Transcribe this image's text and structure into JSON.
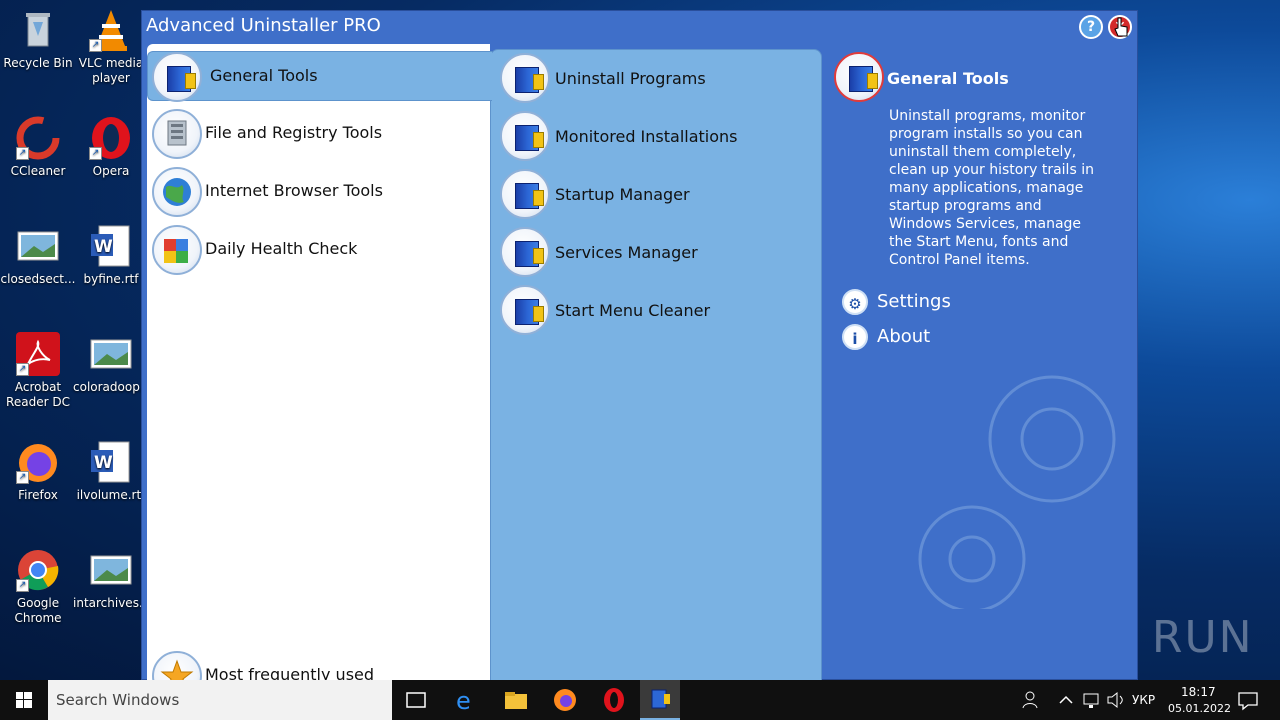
{
  "desktop": {
    "icons": [
      {
        "label": "Recycle Bin"
      },
      {
        "label": "VLC media player"
      },
      {
        "label": "CCleaner"
      },
      {
        "label": "Opera"
      },
      {
        "label": "closedsect..."
      },
      {
        "label": "byfine.rtf"
      },
      {
        "label": "Acrobat Reader DC"
      },
      {
        "label": "coloradoop..."
      },
      {
        "label": "Firefox"
      },
      {
        "label": "ilvolume.rtf"
      },
      {
        "label": "Google Chrome"
      },
      {
        "label": "intarchives..."
      }
    ],
    "watermark": "ANY RUN"
  },
  "window": {
    "title": "Advanced Uninstaller PRO",
    "help_glyph": "?",
    "close_glyph": "✕"
  },
  "categories": [
    {
      "label": "General Tools",
      "selected": true
    },
    {
      "label": "File and Registry Tools"
    },
    {
      "label": "Internet Browser Tools"
    },
    {
      "label": "Daily Health Check"
    },
    {
      "label": "Most frequently used"
    }
  ],
  "tools": [
    {
      "label": "Uninstall Programs"
    },
    {
      "label": "Monitored Installations"
    },
    {
      "label": "Startup Manager"
    },
    {
      "label": "Services Manager"
    },
    {
      "label": "Start Menu Cleaner"
    }
  ],
  "info": {
    "title": "General Tools",
    "description": "Uninstall programs, monitor program installs so you can uninstall them completely, clean up your history trails in many applications, manage startup programs and Windows Services, manage the Start Menu, fonts and Control Panel items.",
    "links": [
      {
        "label": "Settings",
        "glyph": "⚙"
      },
      {
        "label": "About",
        "glyph": "i"
      }
    ]
  },
  "taskbar": {
    "search_placeholder": "Search Windows",
    "language": "УКР",
    "time": "18:17",
    "date": "05.01.2022"
  }
}
